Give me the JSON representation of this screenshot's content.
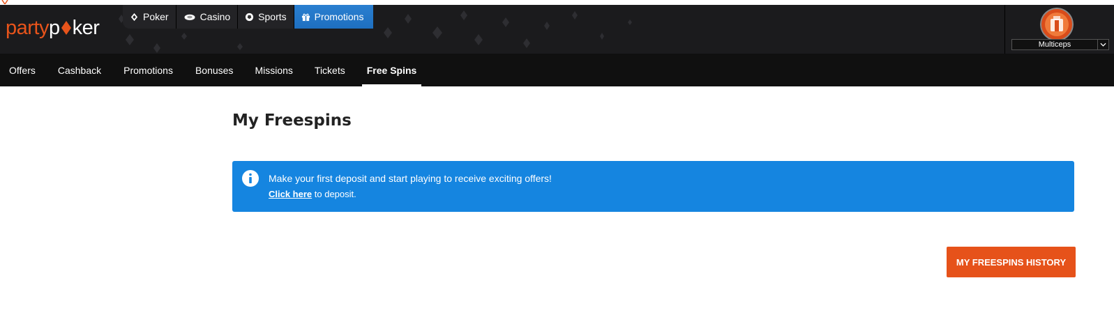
{
  "brand": {
    "name_part1": "party",
    "name_part2": "p",
    "name_part3": "ker",
    "accent": "#e8541b"
  },
  "product_nav": [
    {
      "label": "Poker",
      "icon": "spade-icon"
    },
    {
      "label": "Casino",
      "icon": "chip-icon"
    },
    {
      "label": "Sports",
      "icon": "ball-icon"
    },
    {
      "label": "Promotions",
      "icon": "gift-icon",
      "active": true
    }
  ],
  "user": {
    "name": "Multiceps"
  },
  "subnav": [
    {
      "label": "Offers"
    },
    {
      "label": "Cashback"
    },
    {
      "label": "Promotions"
    },
    {
      "label": "Bonuses"
    },
    {
      "label": "Missions"
    },
    {
      "label": "Tickets"
    },
    {
      "label": "Free Spins",
      "active": true
    }
  ],
  "main": {
    "title": "My Freespins",
    "info": {
      "message": "Make your first deposit and start playing to receive exciting offers!",
      "link_label": "Click here",
      "link_suffix": " to deposit."
    },
    "history_button": "MY FREESPINS HISTORY"
  },
  "colors": {
    "info_bg": "#1585e0",
    "button_bg": "#e6521a",
    "header_bg": "#1b1b1d",
    "subnav_bg": "#101010"
  }
}
